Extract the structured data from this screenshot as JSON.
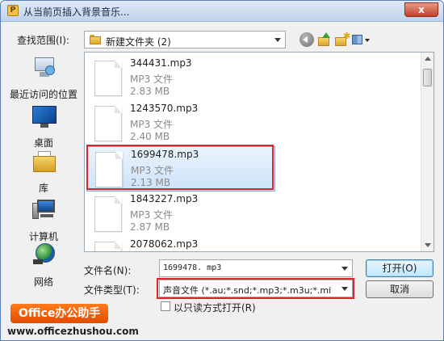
{
  "window": {
    "title": "从当前页插入背景音乐...",
    "close_glyph": "x"
  },
  "lookin": {
    "label": "查找范围(I):",
    "value": "新建文件夹 (2)"
  },
  "places": [
    {
      "label": "最近访问的位置",
      "icon": "recent-places-icon"
    },
    {
      "label": "桌面",
      "icon": "desktop-icon"
    },
    {
      "label": "库",
      "icon": "libraries-icon"
    },
    {
      "label": "计算机",
      "icon": "computer-icon"
    },
    {
      "label": "网络",
      "icon": "network-icon"
    }
  ],
  "files": [
    {
      "name": "344431.mp3",
      "type": "MP3 文件",
      "size": "2.83 MB"
    },
    {
      "name": "1243570.mp3",
      "type": "MP3 文件",
      "size": "2.40 MB"
    },
    {
      "name": "1699478.mp3",
      "type": "MP3 文件",
      "size": "2.13 MB",
      "selected": true
    },
    {
      "name": "1843227.mp3",
      "type": "MP3 文件",
      "size": "2.87 MB"
    },
    {
      "name": "2078062.mp3",
      "type": "",
      "size": ""
    }
  ],
  "form": {
    "filename_label": "文件名(N):",
    "filename_value": "1699478. mp3",
    "filetype_label": "文件类型(T):",
    "filetype_value": "声音文件 (*.au;*.snd;*.mp3;*.m3u;*.mi",
    "readonly_label": "以只读方式打开(R)",
    "readonly_checked": false
  },
  "buttons": {
    "open": "打开(O)",
    "cancel": "取消"
  },
  "watermark": {
    "brand": "Office办公助手",
    "url": "www.officezhushou.com"
  },
  "colors": {
    "highlight": "#d8262b",
    "selection": "#cde3fa",
    "brand": "#e24c00"
  }
}
